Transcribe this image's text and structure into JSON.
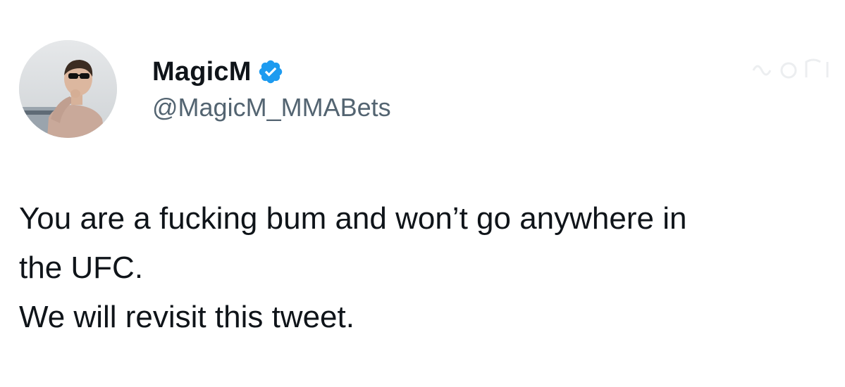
{
  "tweet": {
    "author": {
      "display_name": "MagicM",
      "handle": "@MagicM_MMABets",
      "verified": true,
      "avatar_icon": "user-avatar-photo"
    },
    "body_lines": [
      "You are a fucking bum and won’t go anywhere in",
      "the UFC.",
      "We will revisit this tweet."
    ]
  },
  "colors": {
    "text_primary": "#0f1419",
    "text_secondary": "#536471",
    "verified_badge": "#1d9bf0",
    "background": "#ffffff"
  },
  "icons": {
    "verified": "verified-badge-icon"
  }
}
